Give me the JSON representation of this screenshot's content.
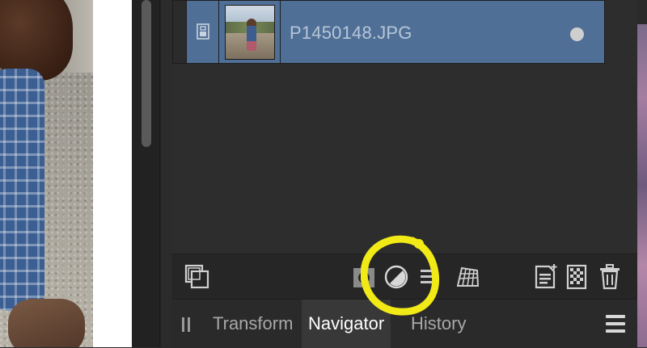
{
  "layers": {
    "items": [
      {
        "name": "P1450148.JPG"
      }
    ]
  },
  "panel_tabs": [
    {
      "label": "Transform"
    },
    {
      "label": "Navigator",
      "active": true
    },
    {
      "label": "History"
    }
  ],
  "toolbar_icons": [
    "arrange-layers-icon",
    "mask-icon",
    "adjustment-icon",
    "live-filter-icon",
    "mesh-warp-icon",
    "add-pixel-layer-icon",
    "fill-layer-icon",
    "delete-layer-icon"
  ],
  "colors": {
    "selected_layer_bg": "#4f6f96",
    "annotation": "#f2ea16",
    "panel_bg": "#2b2b2b"
  }
}
